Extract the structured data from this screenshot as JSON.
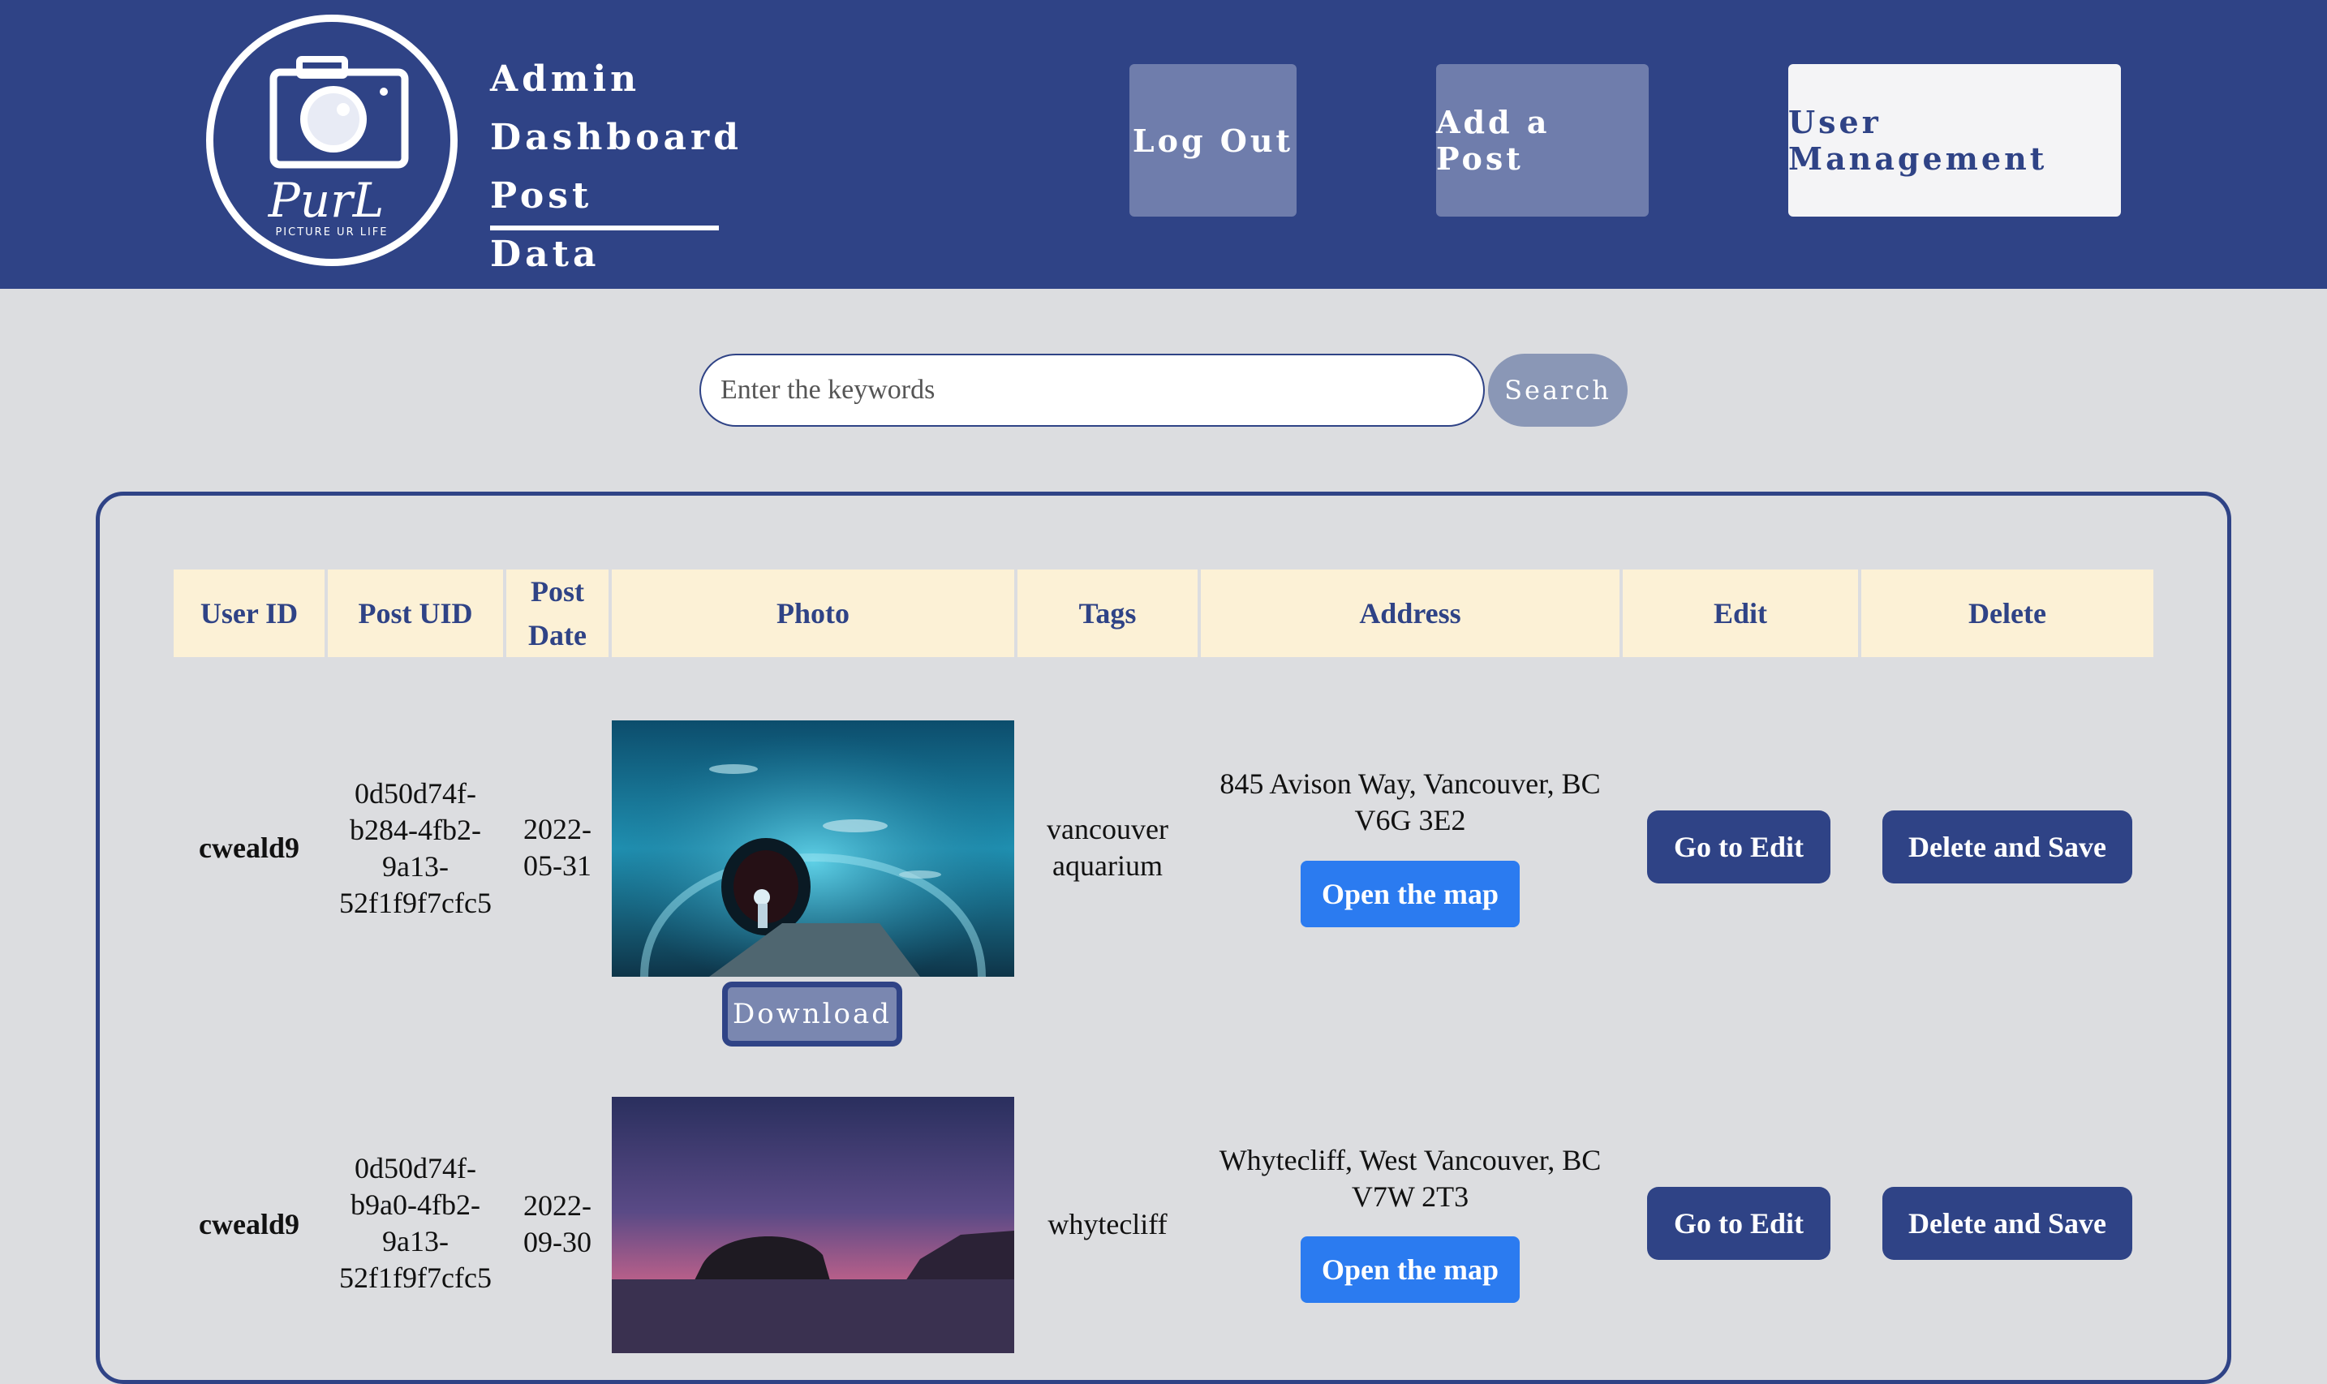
{
  "header": {
    "logo": {
      "script_text": "PurL",
      "tagline": "PICTURE UR LIFE"
    },
    "nav": [
      "Admin",
      "Dashboard",
      "Post Data"
    ],
    "buttons": {
      "logout": "Log Out",
      "add_post": "Add a Post",
      "user_management": "User Management"
    }
  },
  "search": {
    "placeholder": "Enter the keywords",
    "value": "",
    "button": "Search"
  },
  "table": {
    "columns": [
      "User ID",
      "Post UID",
      "Post Date",
      "Photo",
      "Tags",
      "Address",
      "Edit",
      "Delete"
    ],
    "post_date_header": [
      "Post",
      "Date"
    ],
    "rows": [
      {
        "user_id": "cweald9",
        "post_uid_lines": [
          "0d50d74f-",
          "b284-4fb2-",
          "9a13-",
          "52f1f9f7cfc5"
        ],
        "post_date_lines": [
          "2022-",
          "05-31"
        ],
        "photo_icon": "aquarium-tunnel-photo",
        "download": "Download",
        "tags_lines": [
          "vancouver",
          "aquarium"
        ],
        "address_lines": [
          "845 Avison Way, Vancouver, BC",
          "V6G 3E2"
        ],
        "map_button": "Open the map",
        "edit_button": "Go to Edit",
        "delete_button": "Delete and Save"
      },
      {
        "user_id": "cweald9",
        "post_uid_lines": [
          "0d50d74f-",
          "b9a0-4fb2-",
          "9a13-",
          "52f1f9f7cfc5"
        ],
        "post_date_lines": [
          "2022-",
          "09-30"
        ],
        "photo_icon": "whytecliff-sunset-photo",
        "tags_lines": [
          "whytecliff"
        ],
        "address_lines": [
          "Whytecliff, West Vancouver, BC",
          "V7W 2T3"
        ],
        "map_button": "Open the map",
        "edit_button": "Go to Edit",
        "delete_button": "Delete and Save"
      }
    ]
  },
  "colors": {
    "navy": "#2f4386",
    "header_cell": "#fcf1d6",
    "map_blue": "#2b7bf0",
    "page_bg": "#dcdde0"
  }
}
